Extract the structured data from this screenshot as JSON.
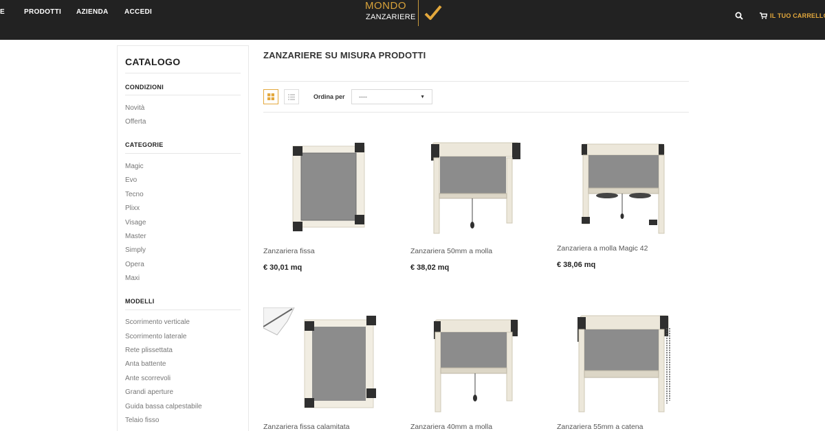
{
  "header": {
    "nav": [
      {
        "label": "E"
      },
      {
        "label": "PRODOTTI"
      },
      {
        "label": "AZIENDA"
      },
      {
        "label": "ACCEDI"
      }
    ],
    "logo": {
      "line1": "MONDO",
      "line2": "ZANZARIERE"
    },
    "cart_label": "IL TUO CARRELLO (",
    "colors": {
      "bar": "#222222",
      "accent": "#e3a83c"
    }
  },
  "sidebar": {
    "title": "CATALOGO",
    "sections": [
      {
        "heading": "CONDIZIONI",
        "items": [
          "Novità",
          "Offerta"
        ]
      },
      {
        "heading": "CATEGORIE",
        "items": [
          "Magic",
          "Evo",
          "Tecno",
          "Plixx",
          "Visage",
          "Master",
          "Simply",
          "Opera",
          "Maxi"
        ]
      },
      {
        "heading": "MODELLI",
        "items": [
          "Scorrimento verticale",
          "Scorrimento laterale",
          "Rete plissettata",
          "Anta battente",
          "Ante scorrevoli",
          "Grandi aperture",
          "Guida bassa calpestabile",
          "Telaio fisso"
        ]
      }
    ]
  },
  "main": {
    "title": "ZANZARIERE SU MISURA PRODOTTI",
    "toolbar": {
      "sort_label": "Ordina per",
      "sort_value": "----",
      "grid_icon": "grid-view-icon",
      "list_icon": "list-view-icon"
    },
    "products": [
      {
        "name": "Zanzariera fissa",
        "price": "€ 30,01 mq",
        "image": "fixed-screen"
      },
      {
        "name": "Zanzariera 50mm a molla",
        "price": "€ 38,02 mq",
        "image": "roller-screen"
      },
      {
        "name": "Zanzariera a molla Magic 42",
        "price": "€ 38,06 mq",
        "image": "roller-screen-magic"
      },
      {
        "name": "Zanzariera fissa calamitata",
        "price": "",
        "image": "fixed-screen-magnetic"
      },
      {
        "name": "Zanzariera 40mm a molla",
        "price": "",
        "image": "roller-screen"
      },
      {
        "name": "Zanzariera 55mm a catena",
        "price": "",
        "image": "chain-screen"
      }
    ]
  }
}
